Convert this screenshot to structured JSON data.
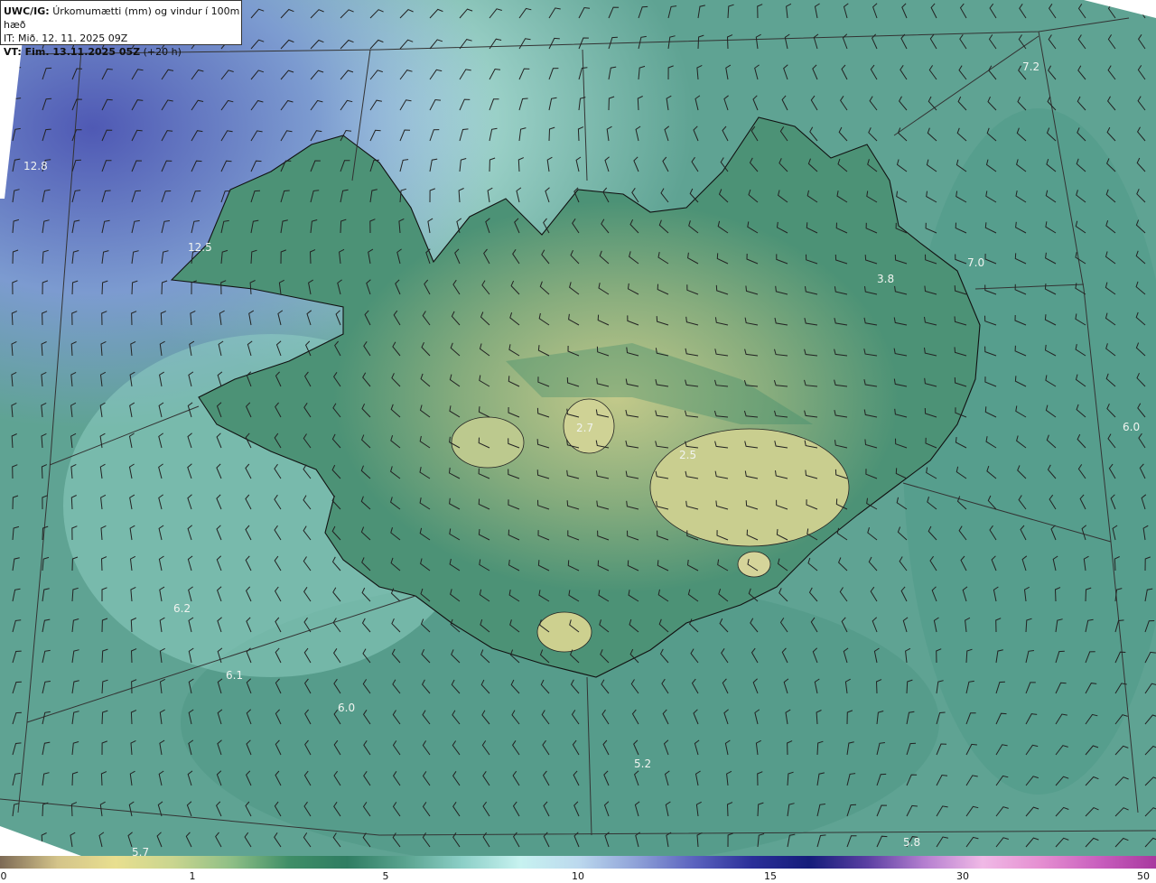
{
  "header": {
    "model": "UWC/IG:",
    "title": "Úrkomumætti (mm) og vindur í 100m hæð",
    "issue_time": "IT: Mið. 12. 11. 2025 09Z",
    "valid_prefix": "VT: Fim. 13.11.2025 05Z",
    "valid_suffix": "(+20 h)"
  },
  "map_labels": [
    {
      "text": "12.8"
    },
    {
      "text": "12.5"
    },
    {
      "text": "7.2"
    },
    {
      "text": "7.0"
    },
    {
      "text": "3.8"
    },
    {
      "text": "6.0"
    },
    {
      "text": "2.7"
    },
    {
      "text": "2.5"
    },
    {
      "text": "6.2"
    },
    {
      "text": "6.1"
    },
    {
      "text": "6.0"
    },
    {
      "text": "5.2"
    },
    {
      "text": "5.8"
    },
    {
      "text": "5.7"
    }
  ],
  "colorbar": {
    "ticks": [
      "0",
      "1",
      "5",
      "10",
      "15",
      "30",
      "50"
    ],
    "colors": [
      "#7d6a55",
      "#d4c48a",
      "#e8df8f",
      "#c9d58f",
      "#8fbf86",
      "#3f8e67",
      "#2f7d62",
      "#5aa38f",
      "#8ccfc7",
      "#c7f2f0",
      "#bcd9ee",
      "#8fa2d8",
      "#5b63bf",
      "#2b2f99",
      "#141c7a",
      "#5a3fa2",
      "#b57fd0",
      "#f0b9e6",
      "#e58fd1",
      "#c95fbe",
      "#a8389f"
    ]
  }
}
